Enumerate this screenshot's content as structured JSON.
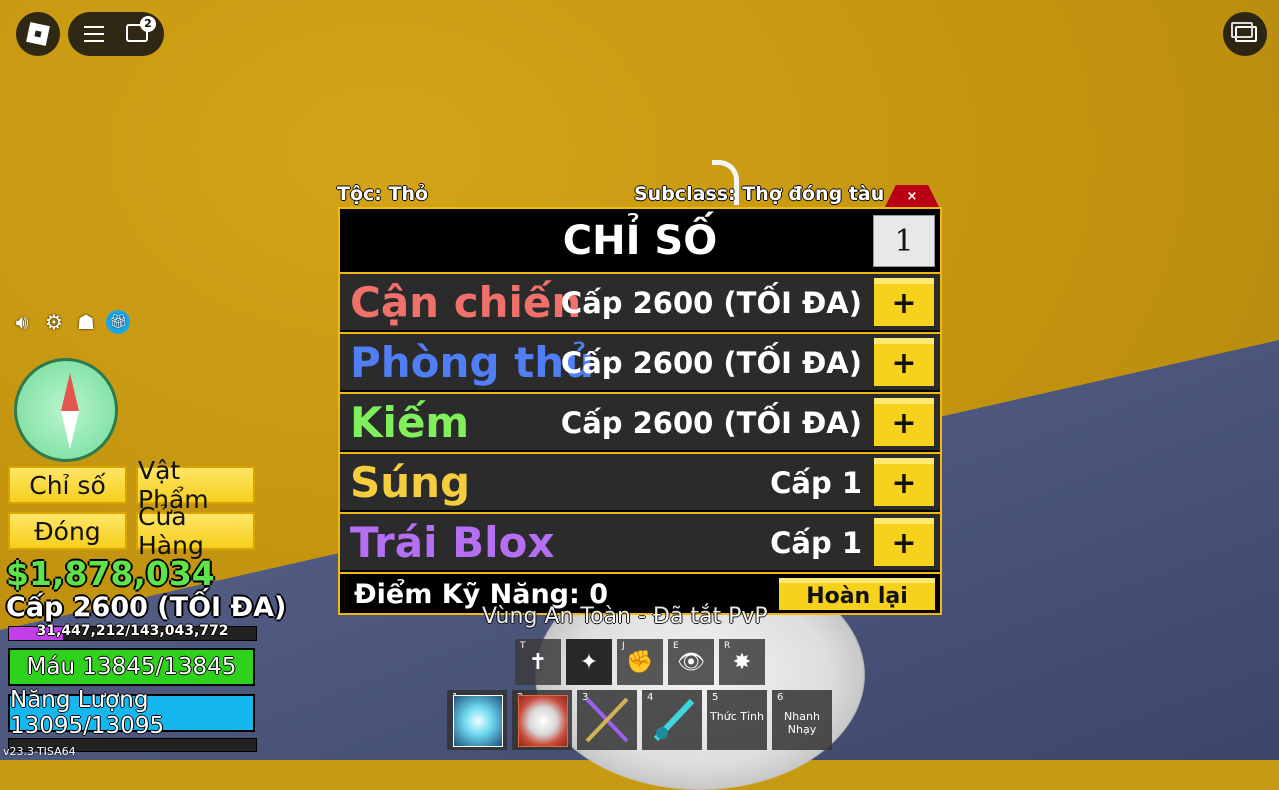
{
  "top_bar": {
    "chat_badge_count": "2"
  },
  "hud": {
    "buttons": {
      "stats": "Chỉ số",
      "items": "Vật Phẩm",
      "close": "Đóng",
      "shop": "Cửa Hàng"
    },
    "money": "$1,878,034",
    "level": "Cấp 2600 (TỐI ĐA)",
    "xp_text": "31,447,212/143,043,772",
    "xp_fraction": 0.22,
    "health_text": "Máu 13845/13845",
    "energy_text": "Năng Lượng 13095/13095",
    "health_color": "#2ed11b",
    "energy_color": "#16b7ef",
    "version": "v23.3-TISA64"
  },
  "panel": {
    "race_label": "Tộc: Thỏ",
    "subclass_label": "Subclass: Thợ đóng tàu",
    "close_symbol": "×",
    "title": "CHỈ SỐ",
    "points_input": "1",
    "stats": [
      {
        "name": "Cận chiến",
        "level": "Cấp 2600 (TỐI ĐA)",
        "color": "#f0706a"
      },
      {
        "name": "Phòng thủ",
        "level": "Cấp 2600 (TỐI ĐA)",
        "color": "#4f7ef5"
      },
      {
        "name": "Kiếm",
        "level": "Cấp 2600 (TỐI ĐA)",
        "color": "#7ff05b"
      },
      {
        "name": "Súng",
        "level": "Cấp 1",
        "color": "#f5cd3d"
      },
      {
        "name": "Trái Blox",
        "level": "Cấp 1",
        "color": "#b46ff2"
      }
    ],
    "plus_label": "+",
    "skill_points": "Điểm Kỹ Năng: 0",
    "reset_label": "Hoàn lại"
  },
  "zone_text": "Vùng An Toàn - Đã tắt PvP",
  "skills": [
    {
      "key": "T",
      "icon": "✝"
    },
    {
      "key": "",
      "icon": "✦"
    },
    {
      "key": "J",
      "icon": "✊"
    },
    {
      "key": "E",
      "icon": "👁"
    },
    {
      "key": "R",
      "icon": "✸"
    }
  ],
  "hotbar": [
    {
      "num": "1",
      "label": ""
    },
    {
      "num": "2",
      "label": ""
    },
    {
      "num": "3",
      "label": ""
    },
    {
      "num": "4",
      "label": ""
    },
    {
      "num": "5",
      "label": "Thức Tỉnh"
    },
    {
      "num": "6",
      "label": "Nhanh Nhạy"
    }
  ]
}
